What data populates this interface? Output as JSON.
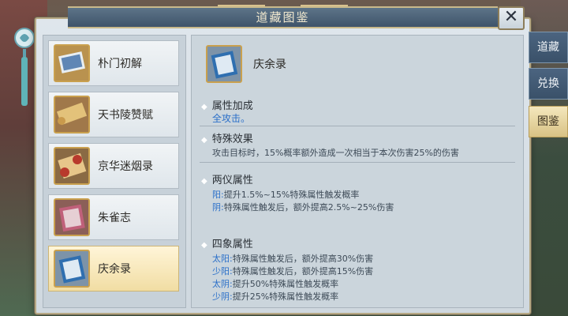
{
  "window": {
    "title": "道藏图鉴",
    "close_glyph": "✕"
  },
  "books": [
    {
      "label": "朴门初解",
      "selected": false,
      "icon": "scroll-book-icon"
    },
    {
      "label": "天书陵赞赋",
      "selected": false,
      "icon": "unrolled-scroll-icon"
    },
    {
      "label": "京华迷烟录",
      "selected": false,
      "icon": "red-scroll-icon"
    },
    {
      "label": "朱雀志",
      "selected": false,
      "icon": "tome-icon"
    },
    {
      "label": "庆余录",
      "selected": true,
      "icon": "blue-book-icon"
    }
  ],
  "detail": {
    "name": "庆余录",
    "sections": {
      "attr": {
        "title": "属性加成",
        "line": "全攻击。"
      },
      "special": {
        "title": "特殊效果",
        "line": "攻击目标时，15%概率额外造成一次相当于本次伤害25%的伤害"
      },
      "liangyi": {
        "title": "两仪属性",
        "rows": [
          {
            "key": "阳:",
            "text": "提升1.5%~15%特殊属性触发概率"
          },
          {
            "key": "阴:",
            "text": "特殊属性触发后，额外提高2.5%~25%伤害"
          }
        ]
      },
      "sixiang": {
        "title": "四象属性",
        "rows": [
          {
            "key": "太阳:",
            "text": "特殊属性触发后，额外提高30%伤害"
          },
          {
            "key": "少阳:",
            "text": "特殊属性触发后，额外提高15%伤害"
          },
          {
            "key": "太阴:",
            "text": "提升50%特殊属性触发概率"
          },
          {
            "key": "少阴:",
            "text": "提升25%特殊属性触发概率"
          }
        ]
      }
    }
  },
  "side_tabs": [
    {
      "label": "道藏",
      "active": false
    },
    {
      "label": "兑换",
      "active": false
    },
    {
      "label": "图鉴",
      "active": true
    }
  ],
  "colors": {
    "accent_blue": "#2a6fc9",
    "gold": "#c9a04e",
    "selected_bg": "#f1dda3"
  }
}
